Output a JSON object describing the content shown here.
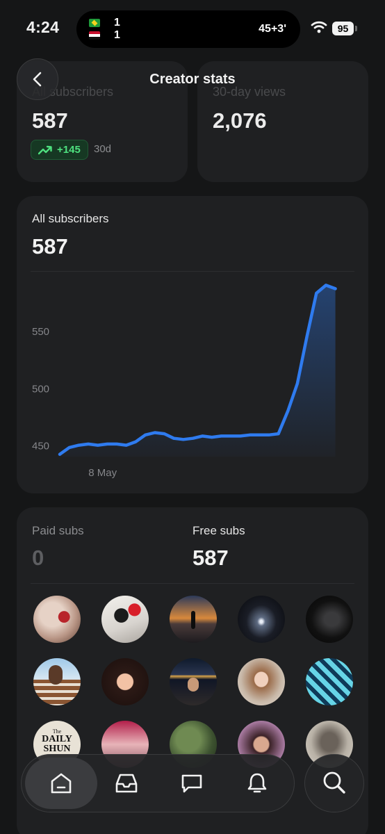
{
  "status_bar": {
    "time": "4:24",
    "live_activity": {
      "team1_score": "1",
      "team2_score": "1",
      "match_time": "45+3'"
    },
    "battery": "95"
  },
  "header": {
    "title": "Creator stats"
  },
  "summary": {
    "subscribers_label": "All subscribers",
    "subscribers_value": "587",
    "growth_value": "+145",
    "growth_period": "30d",
    "views_label": "30-day views",
    "views_value": "2,076"
  },
  "chart_card": {
    "label": "All subscribers",
    "value": "587"
  },
  "chart_data": {
    "type": "area",
    "x": [
      0,
      1,
      2,
      3,
      4,
      5,
      6,
      7,
      8,
      9,
      10,
      11,
      12,
      13,
      14,
      15,
      16,
      17,
      18,
      19,
      20,
      21,
      22,
      23,
      24,
      25,
      26,
      27,
      28,
      29,
      30,
      31
    ],
    "x_tick_labels": [
      {
        "index": 1,
        "label": "8 May"
      }
    ],
    "series": [
      {
        "values": [
          442,
          448,
          450,
          451,
          450,
          451,
          451,
          450,
          453,
          459,
          461,
          460,
          456,
          455,
          456,
          458,
          457,
          458,
          458,
          458,
          459,
          459,
          459,
          460,
          480,
          504,
          545,
          583,
          590,
          587
        ]
      }
    ],
    "yticks": [
      450,
      500,
      550
    ],
    "ylim": [
      440,
      600
    ],
    "grid": false,
    "color": "#2f7bef"
  },
  "subs_card": {
    "paid_label": "Paid subs",
    "paid_value": "0",
    "free_label": "Free subs",
    "free_value": "587",
    "avatar_text": {
      "logo_line1": "The",
      "logo_line2": "DAILY",
      "logo_line3": "SHUN"
    }
  },
  "nav": {
    "items": [
      "home-icon",
      "inbox-icon",
      "chat-icon",
      "bell-icon"
    ],
    "search": "search-icon"
  },
  "colors": {
    "accent": "#2f7bef",
    "growth": "#4ee17f",
    "card": "#1f2022",
    "background": "#151617"
  }
}
